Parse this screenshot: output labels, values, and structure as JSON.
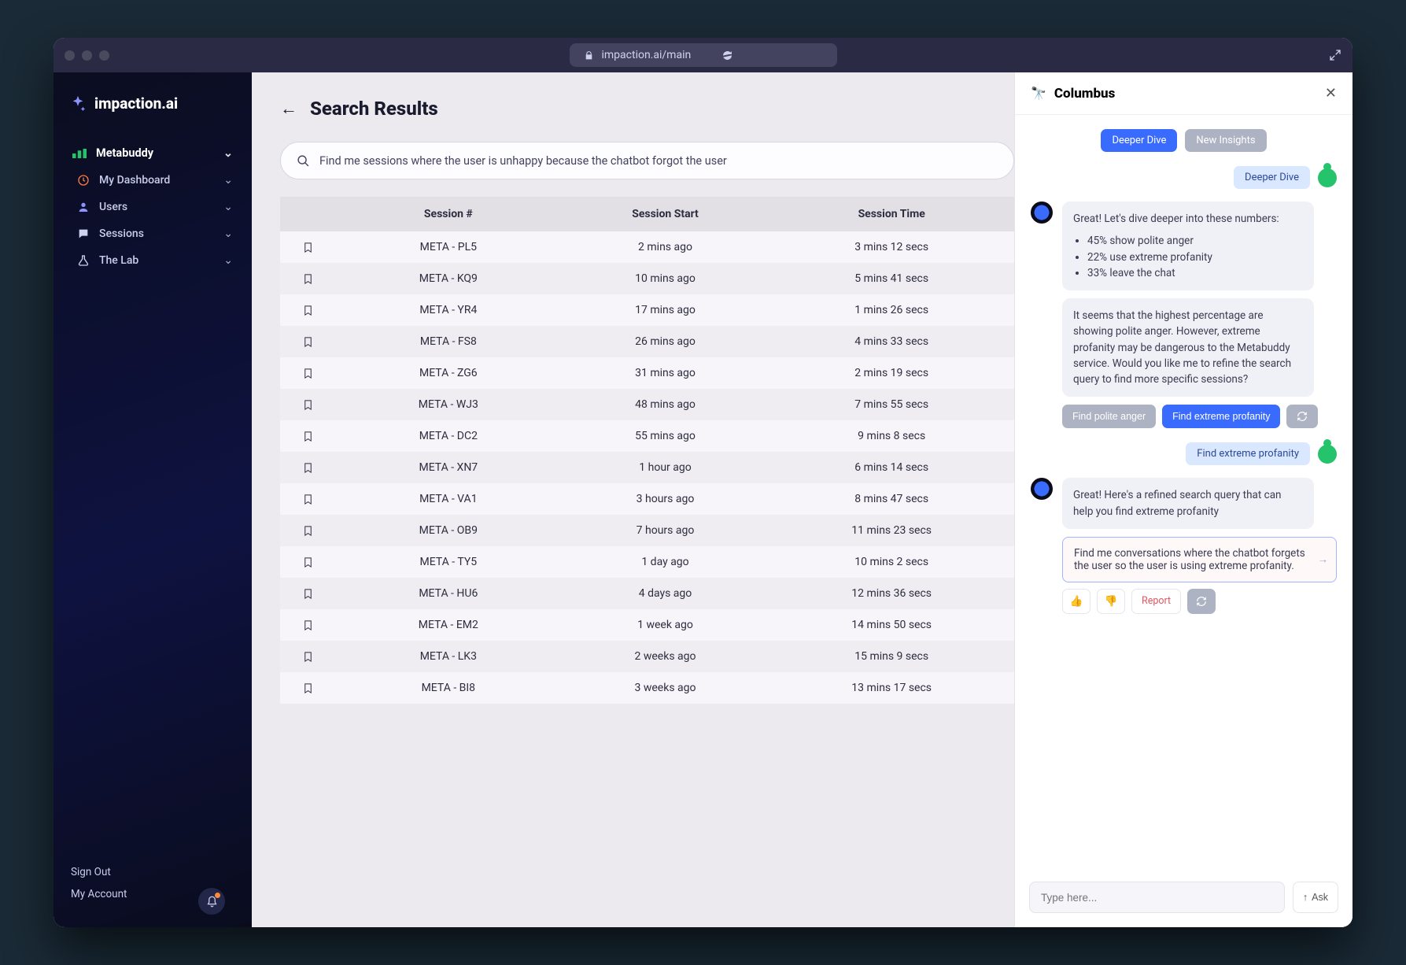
{
  "browser": {
    "url_display": "impaction.ai/main"
  },
  "brand": "impaction.ai",
  "sidebar": {
    "group_label": "Metabuddy",
    "items": [
      {
        "icon": "dashboard",
        "label": "My Dashboard"
      },
      {
        "icon": "user",
        "label": "Users"
      },
      {
        "icon": "chat",
        "label": "Sessions"
      },
      {
        "icon": "flask",
        "label": "The Lab"
      }
    ],
    "sign_out": "Sign Out",
    "my_account": "My Account"
  },
  "search": {
    "title": "Search Results",
    "query": "Find me sessions where the user is unhappy because the chatbot forgot the user"
  },
  "table": {
    "columns": [
      "Session #",
      "Session Start",
      "Session Time"
    ],
    "rows": [
      {
        "id": "META - PL5",
        "start": "2 mins ago",
        "time": "3 mins 12 secs"
      },
      {
        "id": "META - KQ9",
        "start": "10 mins ago",
        "time": "5 mins 41 secs"
      },
      {
        "id": "META - YR4",
        "start": "17 mins ago",
        "time": "1 mins 26 secs"
      },
      {
        "id": "META - FS8",
        "start": "26 mins ago",
        "time": "4 mins 33 secs"
      },
      {
        "id": "META - ZG6",
        "start": "31 mins ago",
        "time": "2 mins 19 secs"
      },
      {
        "id": "META - WJ3",
        "start": "48 mins ago",
        "time": "7 mins 55 secs"
      },
      {
        "id": "META - DC2",
        "start": "55 mins ago",
        "time": "9 mins 8 secs"
      },
      {
        "id": "META - XN7",
        "start": "1 hour ago",
        "time": "6 mins 14 secs"
      },
      {
        "id": "META - VA1",
        "start": "3 hours ago",
        "time": "8 mins 47 secs"
      },
      {
        "id": "META - OB9",
        "start": "7 hours ago",
        "time": "11 mins 23 secs"
      },
      {
        "id": "META - TY5",
        "start": "1 day ago",
        "time": "10 mins 2 secs"
      },
      {
        "id": "META - HU6",
        "start": "4 days ago",
        "time": "12 mins 36 secs"
      },
      {
        "id": "META - EM2",
        "start": "1 week ago",
        "time": "14 mins 50 secs"
      },
      {
        "id": "META - LK3",
        "start": "2 weeks ago",
        "time": "15 mins 9 secs"
      },
      {
        "id": "META - BI8",
        "start": "3 weeks ago",
        "time": "13 mins 17 secs"
      }
    ]
  },
  "panel": {
    "title": "Columbus",
    "suggestions": {
      "deeper": "Deeper Dive",
      "insights": "New Insights"
    },
    "user_chip_1": "Deeper Dive",
    "bot_msg_1_intro": "Great! Let's dive deeper into these numbers:",
    "bot_msg_1_bullets": [
      "45% show polite anger",
      "22% use extreme profanity",
      "33% leave the chat"
    ],
    "bot_msg_1_follow": "It seems that the highest percentage are showing polite anger. However, extreme profanity may be dangerous to the Metabuddy service. Would you like me to refine the search query to find more specific sessions?",
    "action_polite": "Find polite anger",
    "action_profanity": "Find extreme profanity",
    "user_chip_2": "Find extreme profanity",
    "bot_msg_2": "Great! Here's a refined search query that can help you find extreme profanity",
    "refined_query": "Find me conversations where the chatbot forgets the user so the user is using extreme profanity.",
    "report": "Report",
    "input_placeholder": "Type here...",
    "ask_label": "Ask"
  }
}
